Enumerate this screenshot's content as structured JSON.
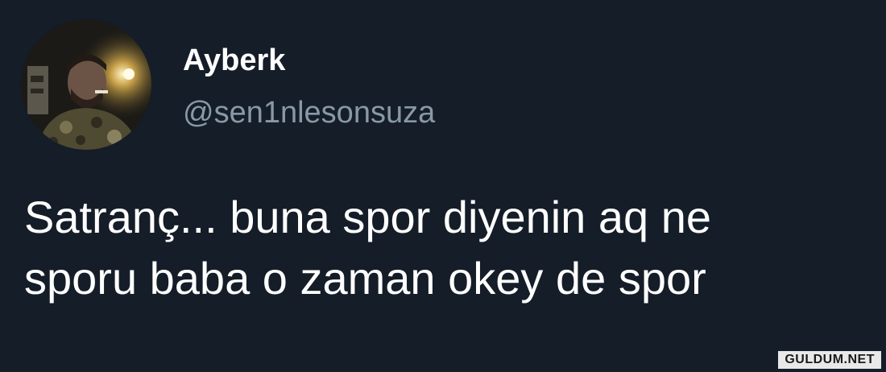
{
  "author": {
    "display_name": "Ayberk",
    "handle": "@sen1nlesonsuza"
  },
  "tweet": {
    "lines": [
      "Satranç... buna spor diyenin aq ne",
      "sporu baba o zaman okey de spor"
    ]
  },
  "watermark": {
    "text": "GULDUM.NET"
  },
  "colors": {
    "background": "#151d28",
    "primary_text": "#ffffff",
    "secondary_text": "#8899a6"
  }
}
